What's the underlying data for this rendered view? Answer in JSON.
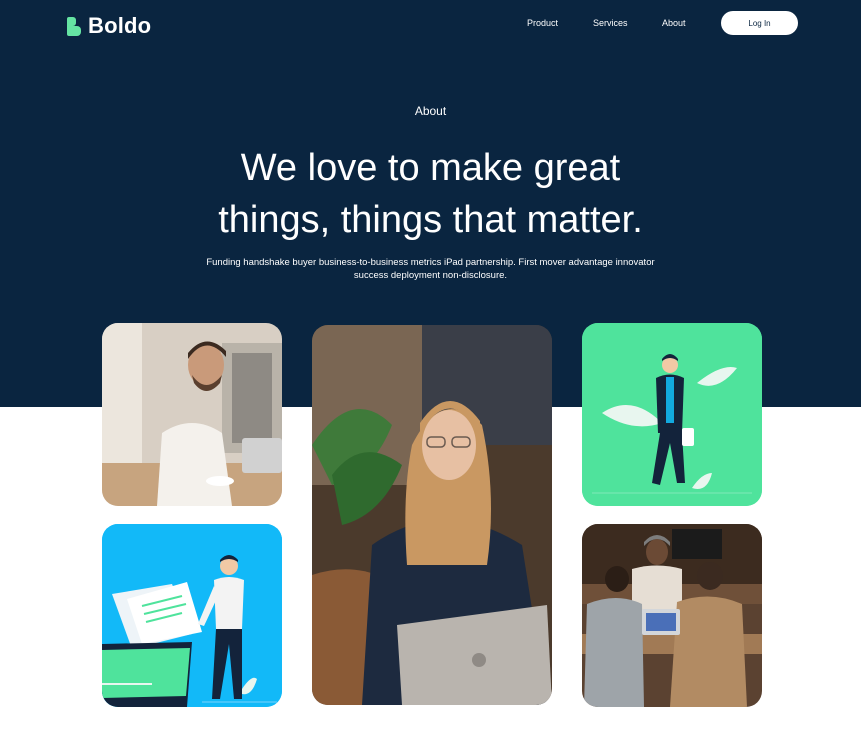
{
  "brand": {
    "name": "Boldo"
  },
  "nav": {
    "links": [
      "Product",
      "Services",
      "About"
    ],
    "login_label": "Log In"
  },
  "hero": {
    "eyebrow": "About",
    "headline_line1": "We love to make great",
    "headline_line2": "things, things that matter.",
    "subtext": "Funding handshake buyer business-to-business metrics iPad partnership. First mover advantage innovator success deployment non-disclosure."
  },
  "colors": {
    "navy": "#0a2540",
    "accent_green": "#65e4a3",
    "card_green": "#4fe39c",
    "card_blue": "#12b9f8"
  }
}
